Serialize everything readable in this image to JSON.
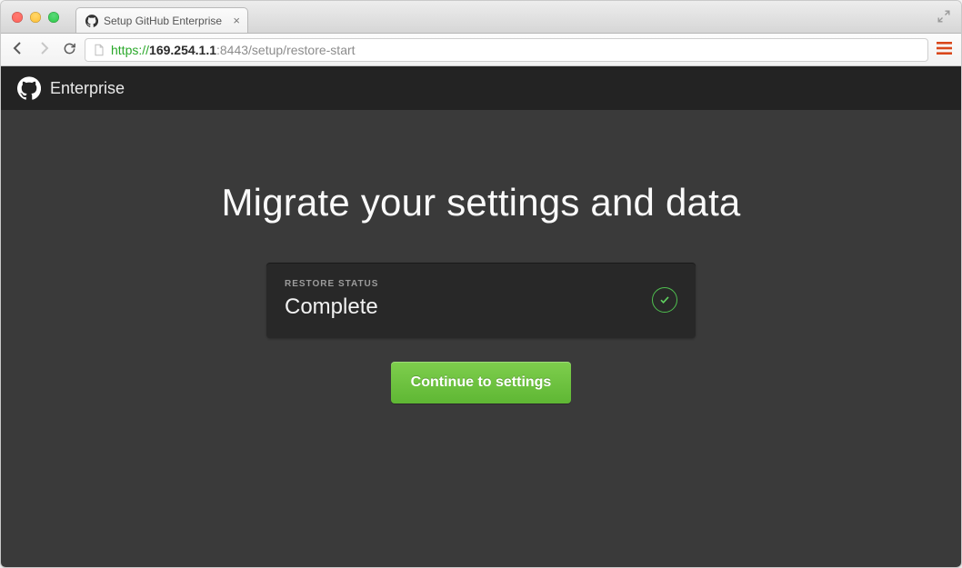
{
  "browser": {
    "tab_title": "Setup GitHub Enterprise",
    "url_scheme": "https://",
    "url_host": "169.254.1.1",
    "url_port": ":8443",
    "url_path": "/setup/restore-start"
  },
  "header": {
    "brand": "Enterprise"
  },
  "main": {
    "title": "Migrate your settings and data",
    "status_label": "RESTORE STATUS",
    "status_value": "Complete",
    "continue_label": "Continue to settings"
  },
  "colors": {
    "accent_green": "#6cc644",
    "page_bg": "#3a3a3a",
    "card_bg": "#282828"
  }
}
